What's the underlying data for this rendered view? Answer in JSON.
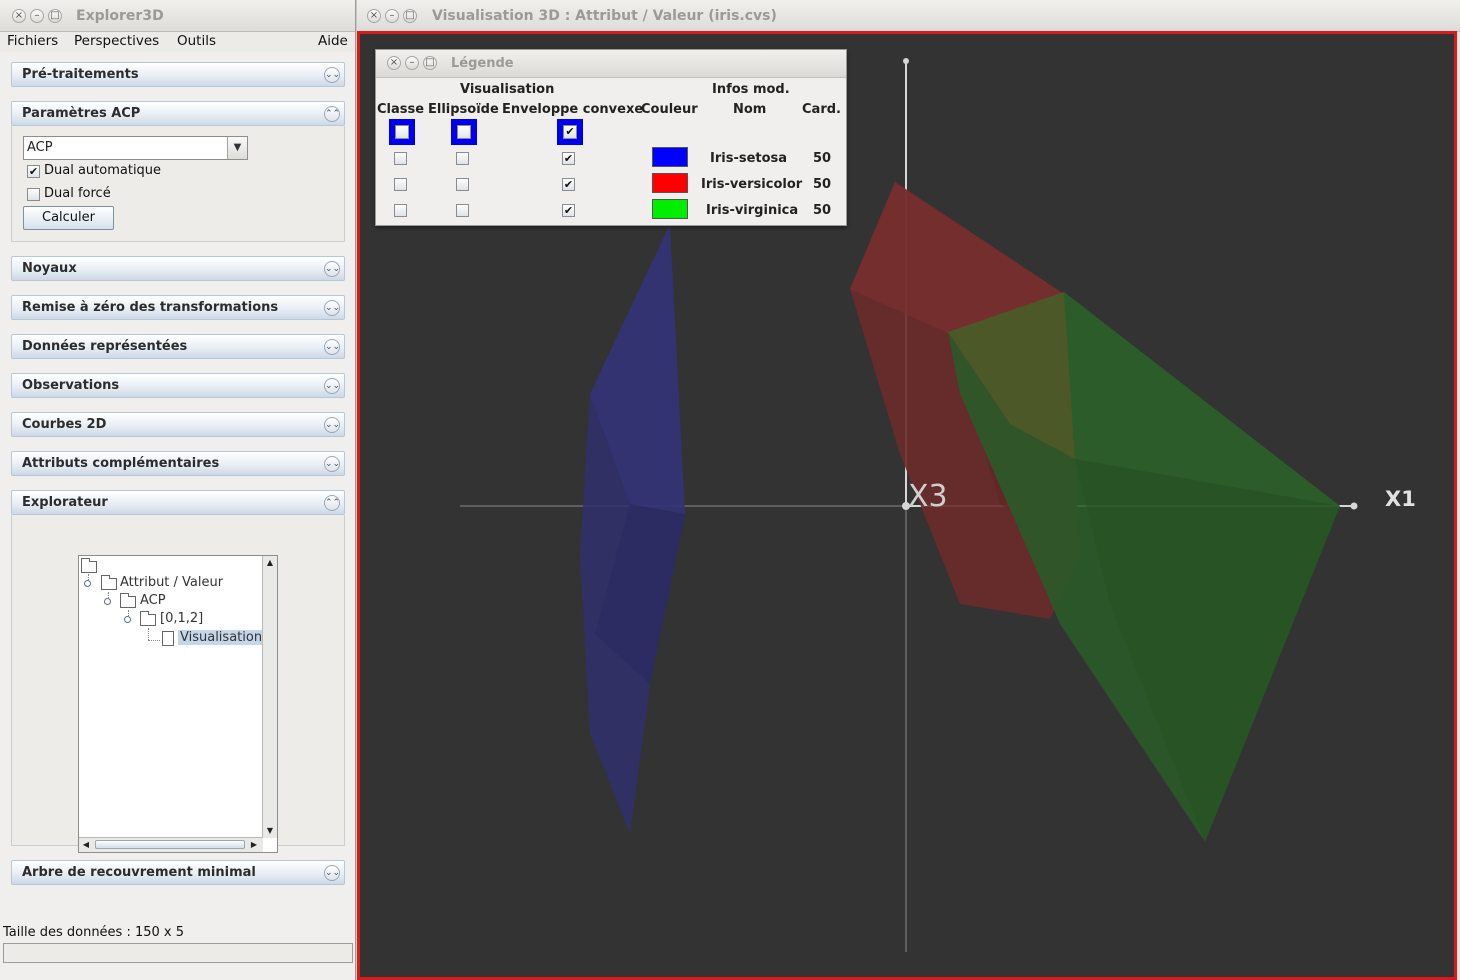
{
  "explorer": {
    "title": "Explorer3D",
    "menu": {
      "fichiers": "Fichiers",
      "perspectives": "Perspectives",
      "outils": "Outils",
      "aide": "Aide"
    },
    "panels": {
      "pretraitements": "Pré-traitements",
      "parametres_acp": "Paramètres ACP",
      "noyaux": "Noyaux",
      "remise": "Remise à zéro des transformations",
      "donnees": "Données représentées",
      "observations": "Observations",
      "courbes": "Courbes 2D",
      "attributs": "Attributs complémentaires",
      "explorateur": "Explorateur",
      "arbre": "Arbre de recouvrement minimal"
    },
    "acp": {
      "method": "ACP",
      "dual_auto_label": "Dual automatique",
      "dual_auto_checked": true,
      "dual_force_label": "Dual forcé",
      "dual_force_checked": false,
      "compute_label": "Calculer"
    },
    "tree": {
      "root": "Attribut / Valeur",
      "child": "ACP",
      "grandchild": "[0,1,2]",
      "leaf": "Visualisation"
    },
    "status": "Taille des données : 150 x 5"
  },
  "viz": {
    "title": "Visualisation 3D : Attribut / Valeur (iris.cvs)",
    "axes": {
      "x1": "X1",
      "x3": "X3"
    },
    "colors": {
      "setosa": "#2e2e6e",
      "versicolor": "#6a2a2a",
      "virginica": "#2c5a2a",
      "border": "#d71a1a"
    }
  },
  "legend": {
    "title": "Légende",
    "group_visualisation": "Visualisation",
    "group_infos": "Infos mod.",
    "col_classe": "Classe",
    "col_ellipsoide": "Ellipsoïde",
    "col_enveloppe": "Enveloppe convexe",
    "col_couleur": "Couleur",
    "col_nom": "Nom",
    "col_card": "Card.",
    "rows": [
      {
        "name": "Iris-setosa",
        "card": "50",
        "color": "#0000ff",
        "classe": false,
        "ellipsoide": false,
        "enveloppe": true
      },
      {
        "name": "Iris-versicolor",
        "card": "50",
        "color": "#ff0000",
        "classe": false,
        "ellipsoide": false,
        "enveloppe": true
      },
      {
        "name": "Iris-virginica",
        "card": "50",
        "color": "#00ee00",
        "classe": false,
        "ellipsoide": false,
        "enveloppe": true
      }
    ]
  }
}
